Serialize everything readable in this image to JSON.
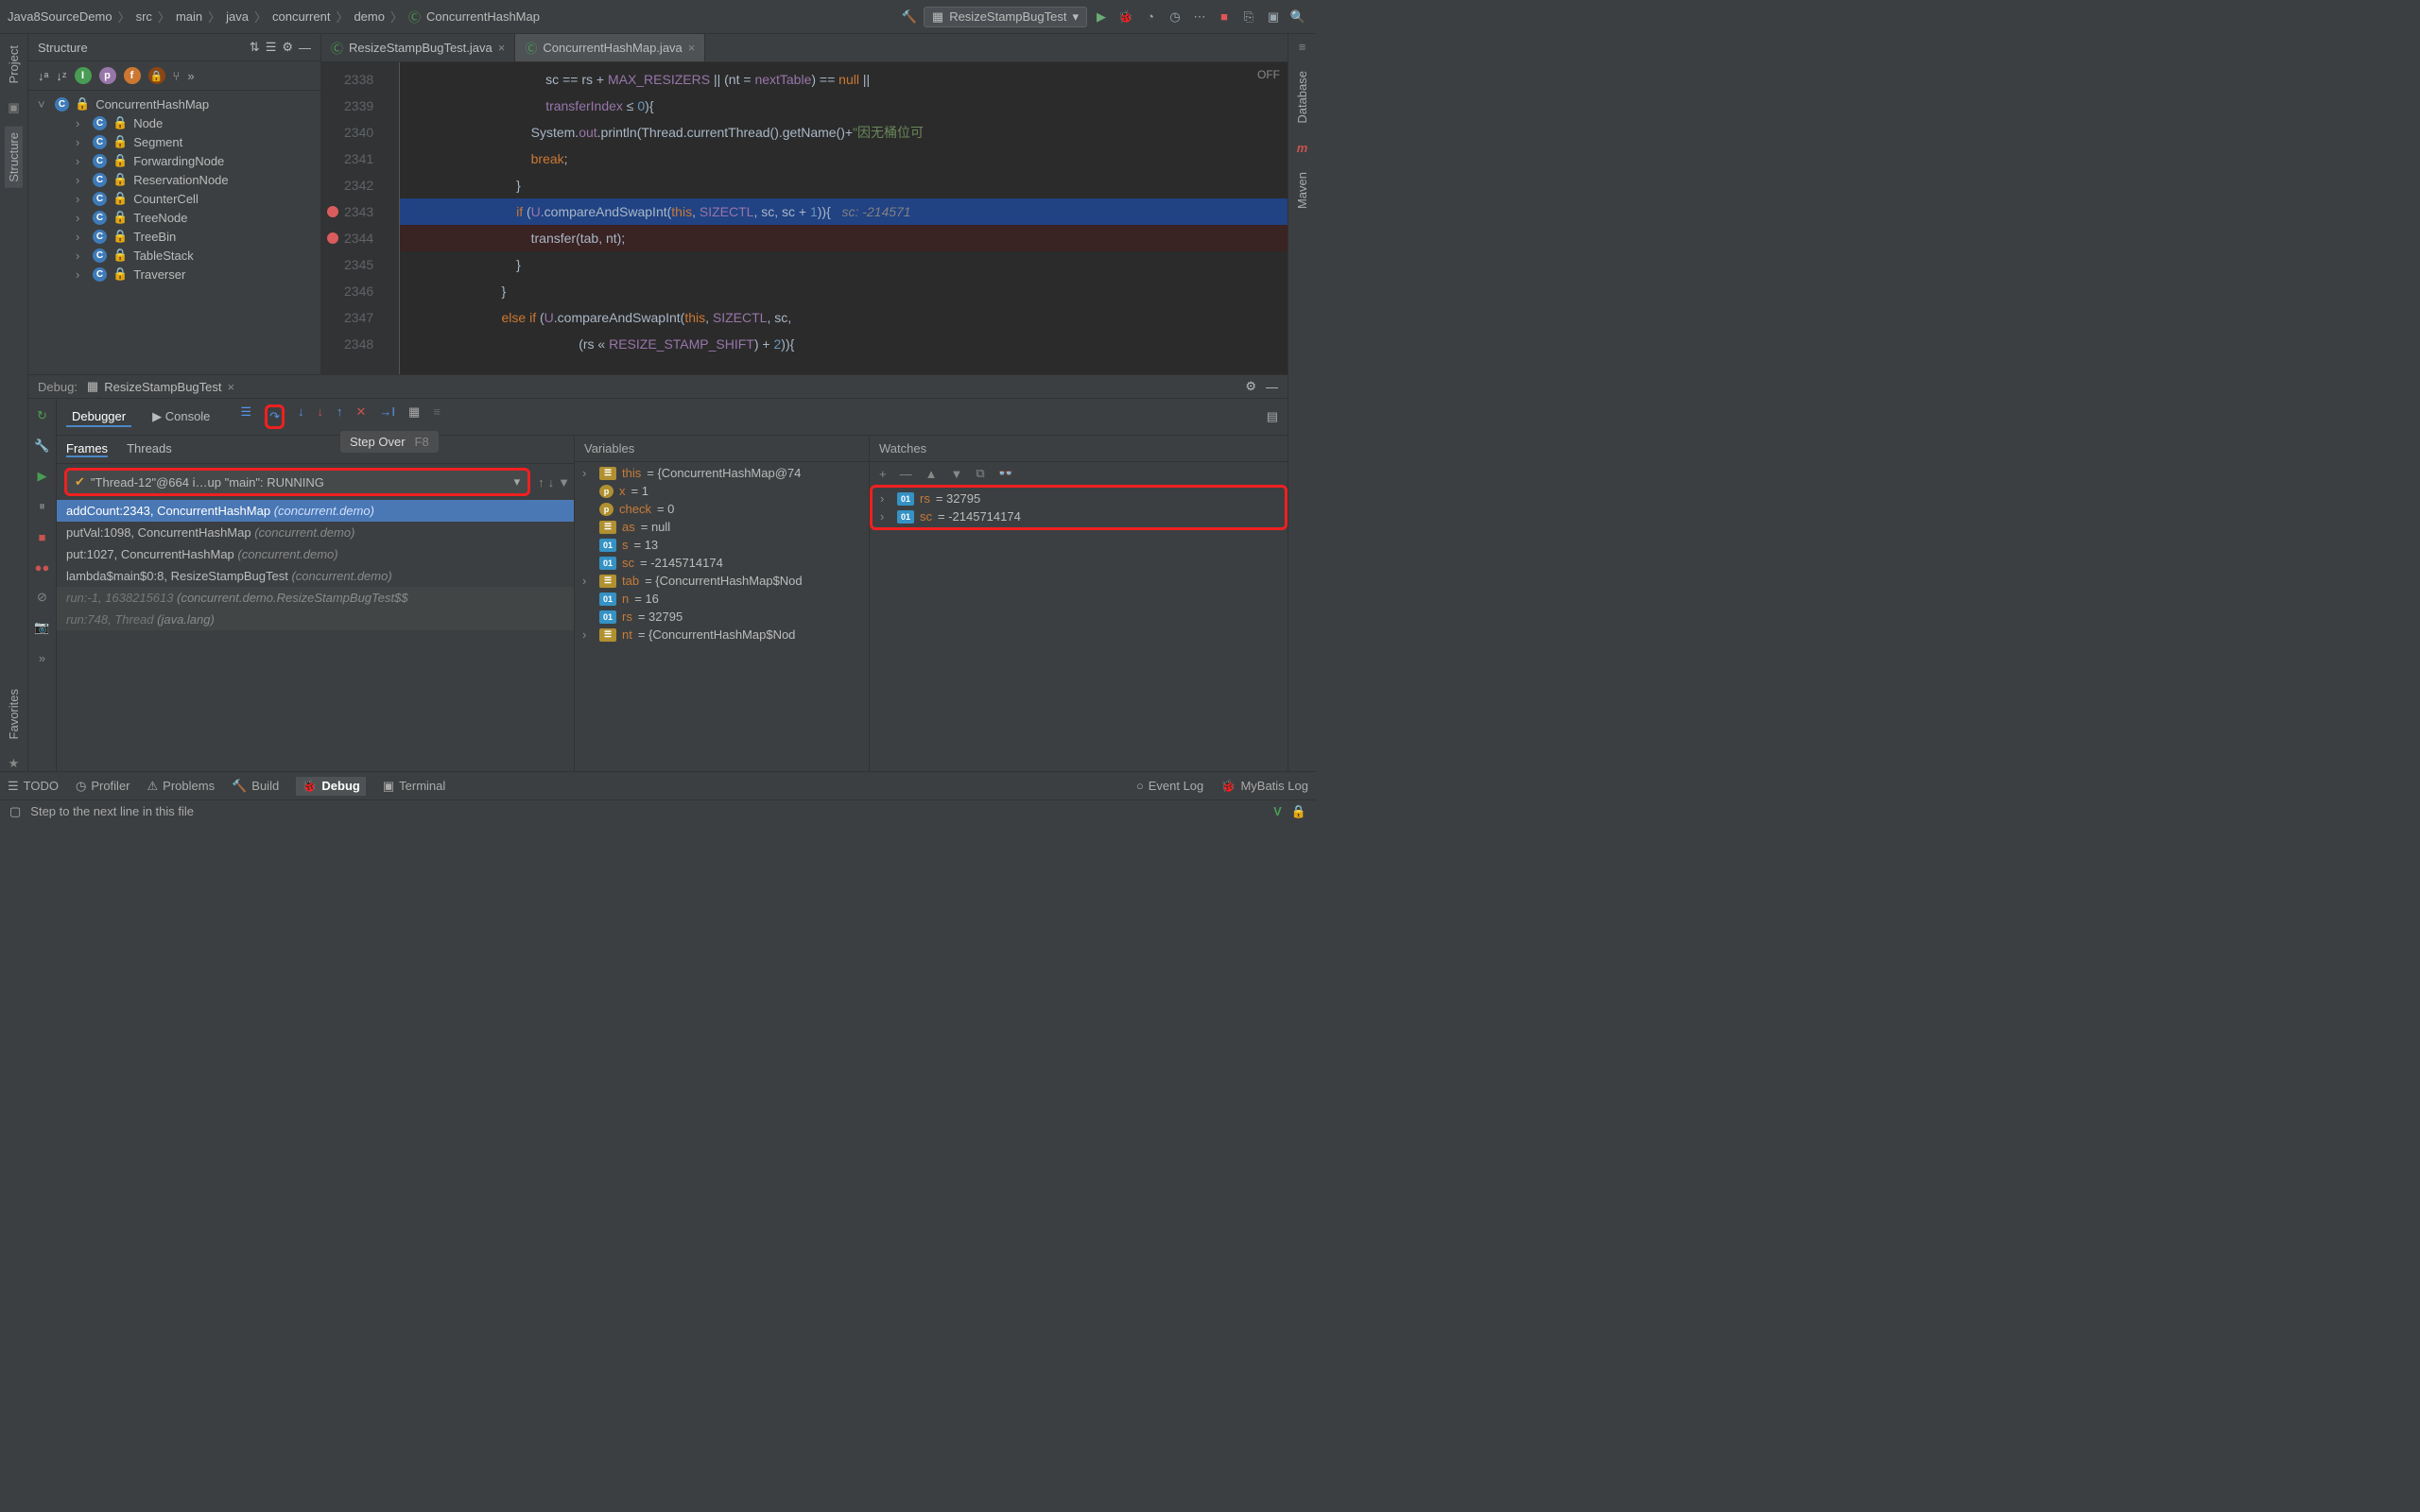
{
  "breadcrumbs": [
    "Java8SourceDemo",
    "src",
    "main",
    "java",
    "concurrent",
    "demo",
    "ConcurrentHashMap"
  ],
  "run_config": "ResizeStampBugTest",
  "structure": {
    "title": "Structure",
    "root": "ConcurrentHashMap",
    "nodes": [
      "Node",
      "Segment",
      "ForwardingNode",
      "ReservationNode",
      "CounterCell",
      "TreeNode",
      "TreeBin",
      "TableStack",
      "Traverser"
    ]
  },
  "tabs": [
    {
      "name": "ResizeStampBugTest.java",
      "active": false
    },
    {
      "name": "ConcurrentHashMap.java",
      "active": true
    }
  ],
  "off_label": "OFF",
  "code": {
    "start": 2338,
    "lines": [
      {
        "n": 2338,
        "html": "                                    sc == rs + <span class='fld'>MAX_RESIZERS</span> || (nt = <span class='fld'>nextTable</span>) == <span class='kw'>null</span> ||"
      },
      {
        "n": 2339,
        "html": "                                    <span class='fld'>transferIndex</span> &#x2264; <span class='num'>0</span>){"
      },
      {
        "n": 2340,
        "html": "                                System.<span class='fld'>out</span>.println(Thread.currentThread().getName()+<span class='str'>\"因无桶位可</span>"
      },
      {
        "n": 2341,
        "html": "                                <span class='kw'>break</span>;"
      },
      {
        "n": 2342,
        "html": "                            }"
      },
      {
        "n": 2343,
        "html": "                            <span class='kw'>if</span> (<span class='fld'>U</span>.compareAndSwapInt(<span class='this'>this</span>, <span class='fld'>SIZECTL</span>, sc, sc + <span class='num'>1</span>)){   <span class='cmt'>sc: -214571</span>",
        "hl": true,
        "bp": true
      },
      {
        "n": 2344,
        "html": "                                transfer(tab, nt);",
        "bp": true
      },
      {
        "n": 2345,
        "html": "                            }"
      },
      {
        "n": 2346,
        "html": "                        }"
      },
      {
        "n": 2347,
        "html": "                        <span class='kw'>else if</span> (<span class='fld'>U</span>.compareAndSwapInt(<span class='this'>this</span>, <span class='fld'>SIZECTL</span>, sc,"
      },
      {
        "n": 2348,
        "html": "                                             (rs &#x00AB; <span class='fld'>RESIZE_STAMP_SHIFT</span>) + <span class='num'>2</span>)){"
      }
    ]
  },
  "debug": {
    "title": "Debug:",
    "config": "ResizeStampBugTest",
    "tabs": {
      "debugger": "Debugger",
      "console": "Console"
    },
    "tooltip": {
      "label": "Step Over",
      "short": "F8"
    },
    "frames_title": "Frames",
    "threads_title": "Threads",
    "thread_selector": "\"Thread-12\"@664 i…up \"main\": RUNNING",
    "frames": [
      {
        "text": "addCount:2343, ConcurrentHashMap",
        "pkg": "(concurrent.demo)",
        "sel": true
      },
      {
        "text": "putVal:1098, ConcurrentHashMap",
        "pkg": "(concurrent.demo)"
      },
      {
        "text": "put:1027, ConcurrentHashMap",
        "pkg": "(concurrent.demo)"
      },
      {
        "text": "lambda$main$0:8, ResizeStampBugTest",
        "pkg": "(concurrent.demo)"
      },
      {
        "text": "run:-1, 1638215613",
        "pkg": "(concurrent.demo.ResizeStampBugTest$$",
        "dim": true
      },
      {
        "text": "run:748, Thread",
        "pkg": "(java.lang)",
        "dim": true
      }
    ],
    "variables_title": "Variables",
    "variables": [
      {
        "icon": "obj",
        "name": "this",
        "val": "= {ConcurrentHashMap@74",
        "exp": true
      },
      {
        "icon": "p",
        "name": "x",
        "val": "= 1"
      },
      {
        "icon": "p",
        "name": "check",
        "val": "= 0"
      },
      {
        "icon": "obj",
        "name": "as",
        "val": "= null"
      },
      {
        "icon": "prim",
        "name": "s",
        "val": "= 13"
      },
      {
        "icon": "prim",
        "name": "sc",
        "val": "= -2145714174"
      },
      {
        "icon": "obj",
        "name": "tab",
        "val": "= {ConcurrentHashMap$Nod",
        "exp": true
      },
      {
        "icon": "prim",
        "name": "n",
        "val": "= 16"
      },
      {
        "icon": "prim",
        "name": "rs",
        "val": "= 32795"
      },
      {
        "icon": "obj",
        "name": "nt",
        "val": "= {ConcurrentHashMap$Nod",
        "exp": true
      }
    ],
    "watches_title": "Watches",
    "watches": [
      {
        "name": "rs",
        "val": "= 32795"
      },
      {
        "name": "sc",
        "val": "= -2145714174"
      }
    ]
  },
  "bottom": {
    "todo": "TODO",
    "profiler": "Profiler",
    "problems": "Problems",
    "build": "Build",
    "debug": "Debug",
    "terminal": "Terminal",
    "eventlog": "Event Log",
    "mybatis": "MyBatis Log"
  },
  "status_text": "Step to the next line in this file",
  "left_tabs": {
    "project": "Project",
    "structure": "Structure"
  },
  "right_tabs": {
    "database": "Database",
    "maven": "Maven"
  },
  "fav_tab": "Favorites"
}
